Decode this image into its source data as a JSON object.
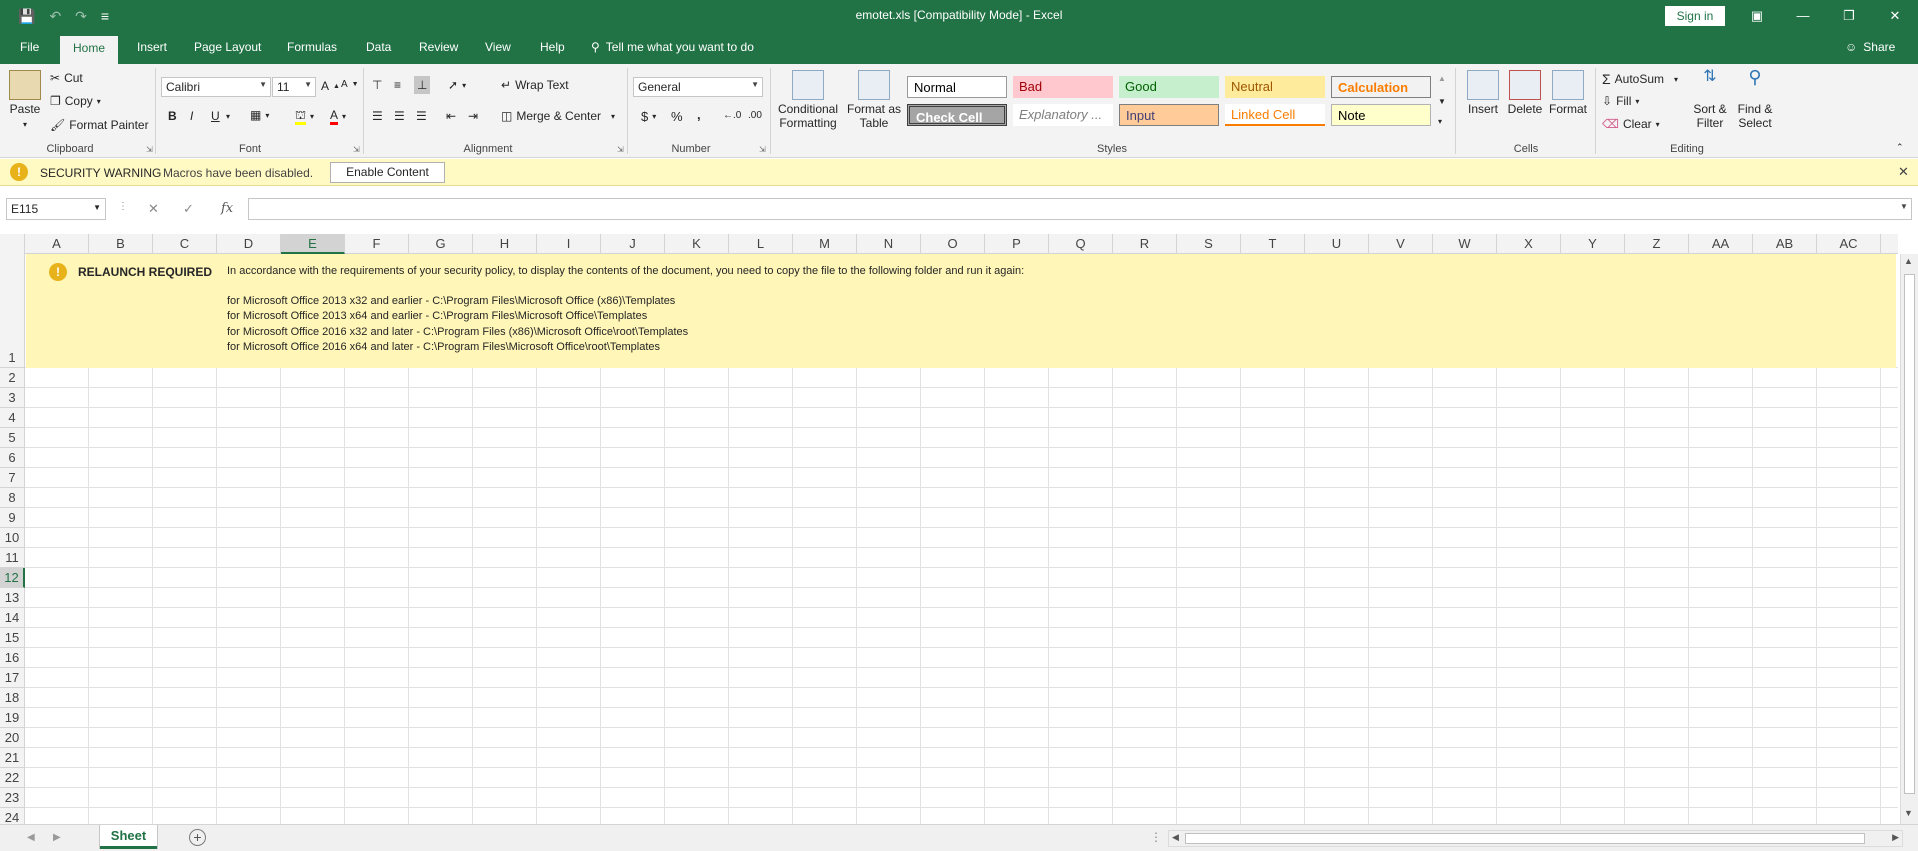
{
  "window": {
    "title": "emotet.xls  [Compatibility Mode]  -  Excel",
    "sign_in": "Sign in",
    "qat_more": "≡"
  },
  "tabs": [
    {
      "label": "File"
    },
    {
      "label": "Home"
    },
    {
      "label": "Insert"
    },
    {
      "label": "Page Layout"
    },
    {
      "label": "Formulas"
    },
    {
      "label": "Data"
    },
    {
      "label": "Review"
    },
    {
      "label": "View"
    },
    {
      "label": "Help"
    }
  ],
  "tell_me": "Tell me what you want to do",
  "share": "Share",
  "ribbon": {
    "clipboard": {
      "paste": "Paste",
      "cut": "Cut",
      "copy": "Copy",
      "format_painter": "Format Painter",
      "label": "Clipboard"
    },
    "font": {
      "name": "Calibri",
      "size": "11",
      "bold": "B",
      "italic": "I",
      "underline": "U",
      "label": "Font"
    },
    "alignment": {
      "wrap_text": "Wrap Text",
      "merge_center": "Merge & Center",
      "label": "Alignment"
    },
    "number": {
      "format": "General",
      "currency": "$",
      "percent": "%",
      "comma": ",",
      "inc_dec": "←.0",
      "dec_dec": ".00",
      "label": "Number"
    },
    "styles": {
      "conditional_formatting": "Conditional Formatting",
      "format_as_table": "Format as Table",
      "label": "Styles",
      "cells": [
        {
          "name": "Normal",
          "bg": "#ffffff",
          "fg": "#000000"
        },
        {
          "name": "Bad",
          "bg": "#ffc7ce",
          "fg": "#9c0006"
        },
        {
          "name": "Good",
          "bg": "#c6efce",
          "fg": "#006100"
        },
        {
          "name": "Neutral",
          "bg": "#ffeb9c",
          "fg": "#9c5700"
        },
        {
          "name": "Calculation",
          "bg": "#f2f2f2",
          "fg": "#fa7d00"
        },
        {
          "name": "Check Cell",
          "bg": "#a5a5a5",
          "fg": "#ffffff"
        },
        {
          "name": "Explanatory ...",
          "bg": "#ffffff",
          "fg": "#7f7f7f"
        },
        {
          "name": "Input",
          "bg": "#ffcc99",
          "fg": "#3f3f76"
        },
        {
          "name": "Linked Cell",
          "bg": "#ffffff",
          "fg": "#fa7d00"
        },
        {
          "name": "Note",
          "bg": "#ffffcc",
          "fg": "#000000"
        }
      ]
    },
    "cells": {
      "insert": "Insert",
      "delete": "Delete",
      "format": "Format",
      "label": "Cells"
    },
    "editing": {
      "autosum": "AutoSum",
      "fill": "Fill",
      "clear": "Clear",
      "sort_filter": "Sort & Filter",
      "find_select": "Find & Select",
      "label": "Editing"
    }
  },
  "security": {
    "title": "SECURITY WARNING",
    "message": "Macros have been disabled.",
    "button": "Enable Content"
  },
  "formula_bar": {
    "name_box": "E115",
    "cancel": "✕",
    "enter": "✓",
    "fx": "fx",
    "value": ""
  },
  "columns": [
    "A",
    "B",
    "C",
    "D",
    "E",
    "F",
    "G",
    "H",
    "I",
    "J",
    "K",
    "L",
    "M",
    "N",
    "O",
    "P",
    "Q",
    "R",
    "S",
    "T",
    "U",
    "V",
    "W",
    "X",
    "Y",
    "Z",
    "AA",
    "AB",
    "AC"
  ],
  "rows": [
    "1",
    "2",
    "3",
    "4",
    "5",
    "6",
    "7",
    "8",
    "9",
    "10",
    "11",
    "12",
    "13",
    "14",
    "15",
    "16",
    "17",
    "18",
    "19",
    "20",
    "21",
    "22",
    "23",
    "24"
  ],
  "selected": {
    "column": "E",
    "row": "12"
  },
  "banner": {
    "title": "RELAUNCH REQUIRED",
    "lines": [
      "In accordance with the requirements of your security policy, to display the contents of the document, you need to copy the file to the following folder and run it again:",
      "for Microsoft Office 2013 x32 and earlier - C:\\Program Files\\Microsoft Office (x86)\\Templates",
      "for Microsoft Office 2013 x64 and earlier - C:\\Program Files\\Microsoft Office\\Templates",
      "for Microsoft Office 2016 x32 and later - C:\\Program Files (x86)\\Microsoft Office\\root\\Templates",
      "for Microsoft Office 2016 x64 and later - C:\\Program Files\\Microsoft Office\\root\\Templates"
    ]
  },
  "sheet_tabs": [
    {
      "label": "Sheet"
    }
  ],
  "colors": {
    "brand": "#217346",
    "warning_bg": "#fff9c4",
    "banner_bg": "#fff6b8"
  }
}
